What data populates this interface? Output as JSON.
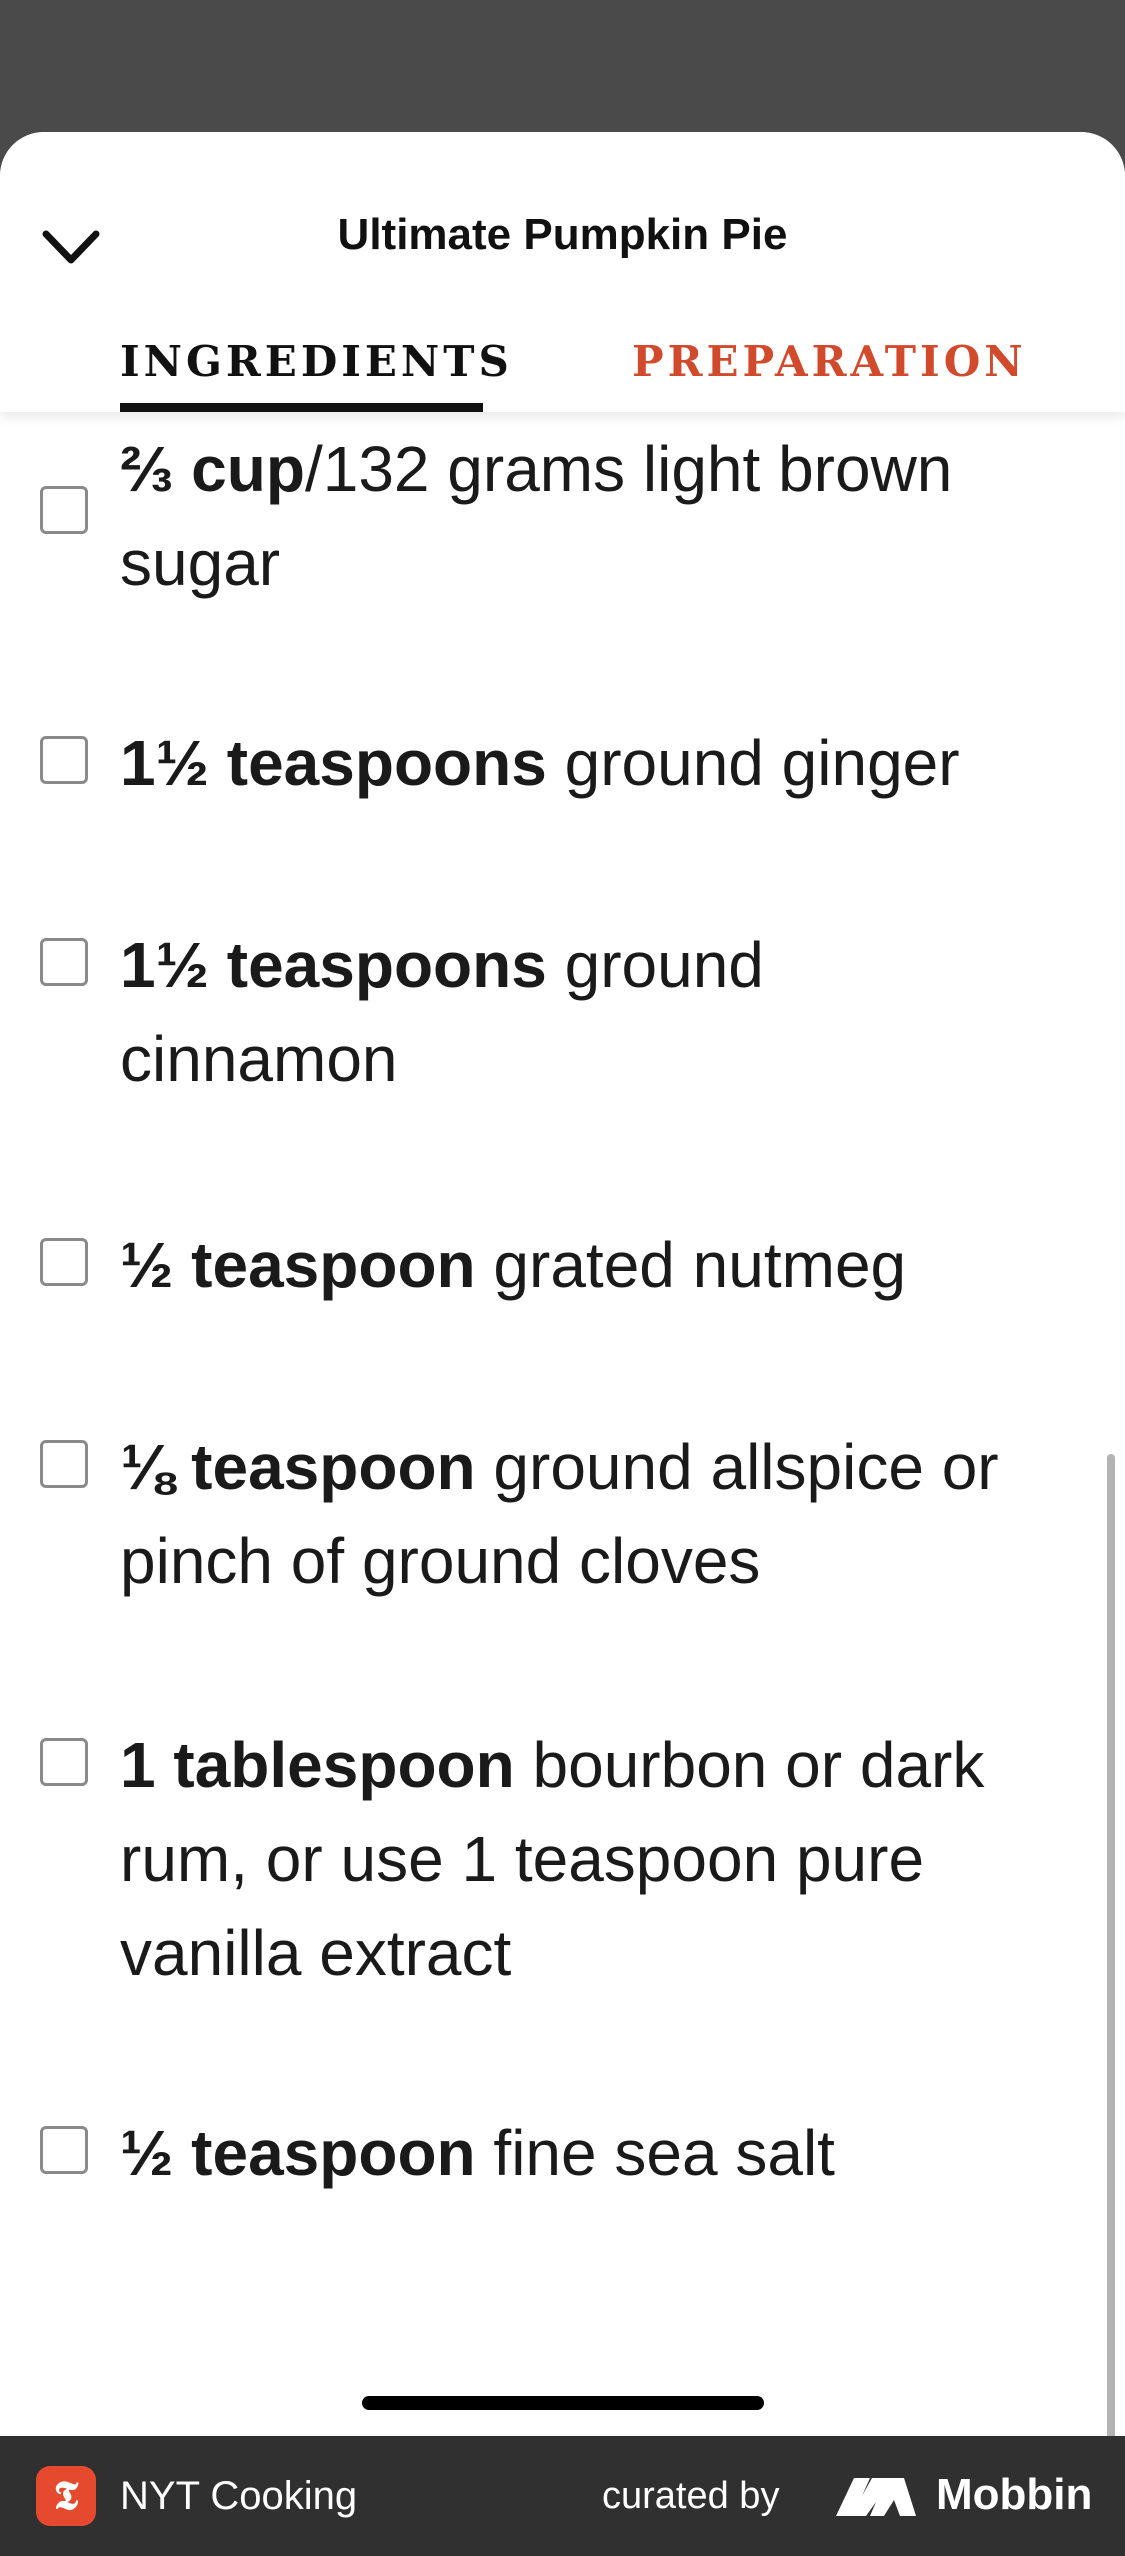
{
  "header": {
    "title": "Ultimate Pumpkin Pie",
    "collapse_icon": "chevron-down-icon"
  },
  "tabs": [
    {
      "label": "INGREDIENTS",
      "active": true
    },
    {
      "label": "PREPARATION",
      "active": false
    }
  ],
  "colors": {
    "accent": "#d14a2b",
    "text": "#111111",
    "backdrop": "#4a4a4a",
    "footer": "#303030"
  },
  "ingredients": [
    {
      "qty": "⅔ cup",
      "sep": "/",
      "text": "132 grams light brown sugar",
      "checked": false
    },
    {
      "qty": "1½ teaspoons",
      "sep": " ",
      "text": "ground ginger",
      "checked": false
    },
    {
      "qty": "1½ teaspoons",
      "sep": " ",
      "text": "ground cinnamon",
      "checked": false
    },
    {
      "qty": "½ teaspoon",
      "sep": " ",
      "text": "grated nutmeg",
      "checked": false
    },
    {
      "qty": "⅛ teaspoon",
      "sep": " ",
      "text": "ground allspice or pinch of ground cloves",
      "checked": false
    },
    {
      "qty": "1 tablespoon",
      "sep": " ",
      "text": "bourbon or dark rum, or use 1 teaspoon pure vanilla extract",
      "checked": false
    },
    {
      "qty": "½ teaspoon",
      "sep": " ",
      "text": "fine sea salt",
      "checked": false
    }
  ],
  "footer": {
    "brand_icon": "nyt-logo-icon",
    "brand_glyph": "𝕿",
    "brand_name": "NYT Cooking",
    "curated_label": "curated by",
    "mobbin_icon": "mobbin-logo-icon",
    "mobbin_label": "Mobbin"
  }
}
